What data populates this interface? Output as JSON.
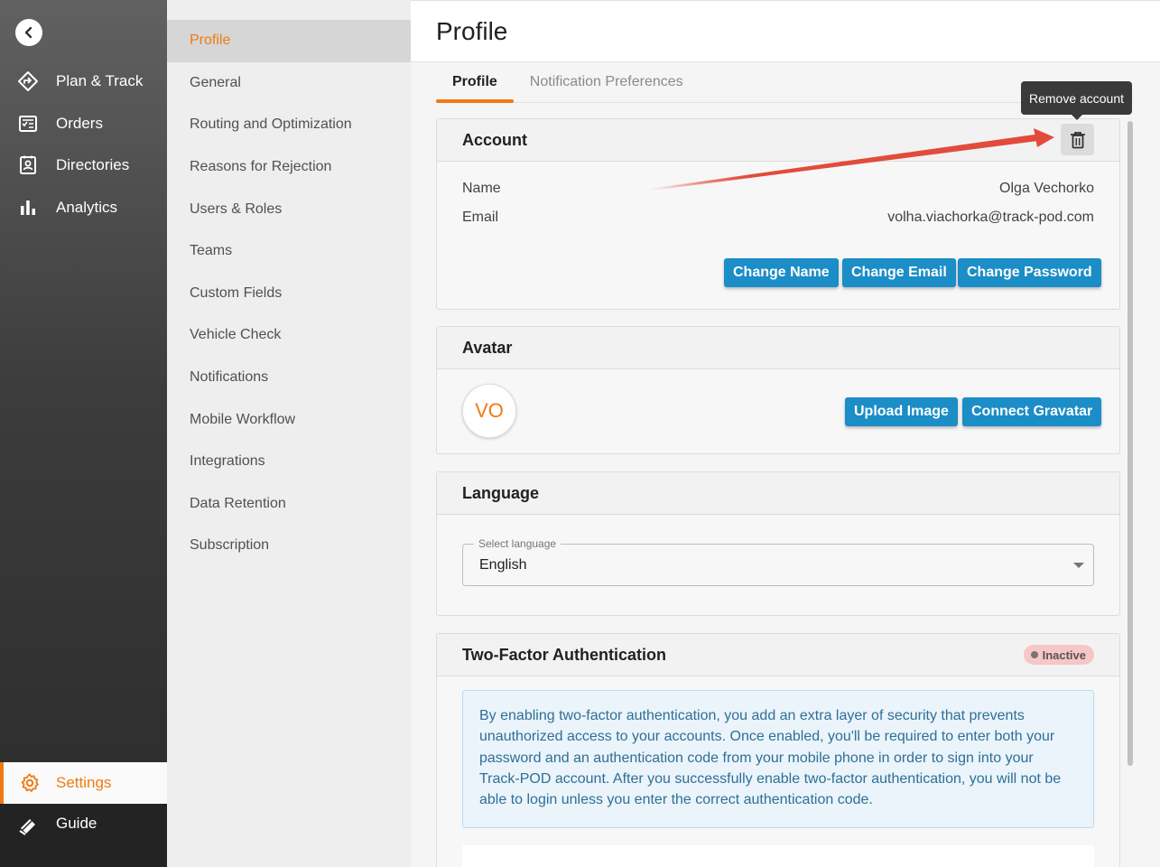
{
  "nav": {
    "items": [
      {
        "label": "Plan & Track",
        "icon": "plan-track-icon"
      },
      {
        "label": "Orders",
        "icon": "orders-icon"
      },
      {
        "label": "Directories",
        "icon": "directories-icon"
      },
      {
        "label": "Analytics",
        "icon": "analytics-icon"
      }
    ],
    "settings": {
      "label": "Settings",
      "icon": "gear-icon"
    },
    "guide": {
      "label": "Guide",
      "icon": "guide-icon"
    }
  },
  "submenu": {
    "items": [
      "Profile",
      "General",
      "Routing and Optimization",
      "Reasons for Rejection",
      "Users & Roles",
      "Teams",
      "Custom Fields",
      "Vehicle Check",
      "Notifications",
      "Mobile Workflow",
      "Integrations",
      "Data Retention",
      "Subscription"
    ],
    "active": "Profile"
  },
  "page": {
    "title": "Profile"
  },
  "tabs": [
    "Profile",
    "Notification Preferences"
  ],
  "tooltip": "Remove account",
  "account": {
    "title": "Account",
    "name_label": "Name",
    "name_value": "Olga Vechorko",
    "email_label": "Email",
    "email_value": "volha.viachorka@track-pod.com",
    "buttons": {
      "change_name": "Change Name",
      "change_email": "Change Email",
      "change_password": "Change Password"
    }
  },
  "avatar": {
    "title": "Avatar",
    "initials": "VO",
    "buttons": {
      "upload": "Upload Image",
      "gravatar": "Connect Gravatar"
    }
  },
  "language": {
    "title": "Language",
    "select_label": "Select language",
    "value": "English"
  },
  "twofa": {
    "title": "Two-Factor Authentication",
    "status": "Inactive",
    "description": "By enabling two-factor authentication, you add an extra layer of security that prevents unauthorized access to your accounts. Once enabled, you'll be required to enter both your password and an authentication code from your mobile phone in order to sign into your Track-POD account. After you successfully enable two-factor authentication, you will not be able to login unless you enter the correct authentication code."
  },
  "colors": {
    "accent": "#f07a12",
    "button": "#1b8dc7",
    "annotation_arrow": "#e24b3b"
  }
}
